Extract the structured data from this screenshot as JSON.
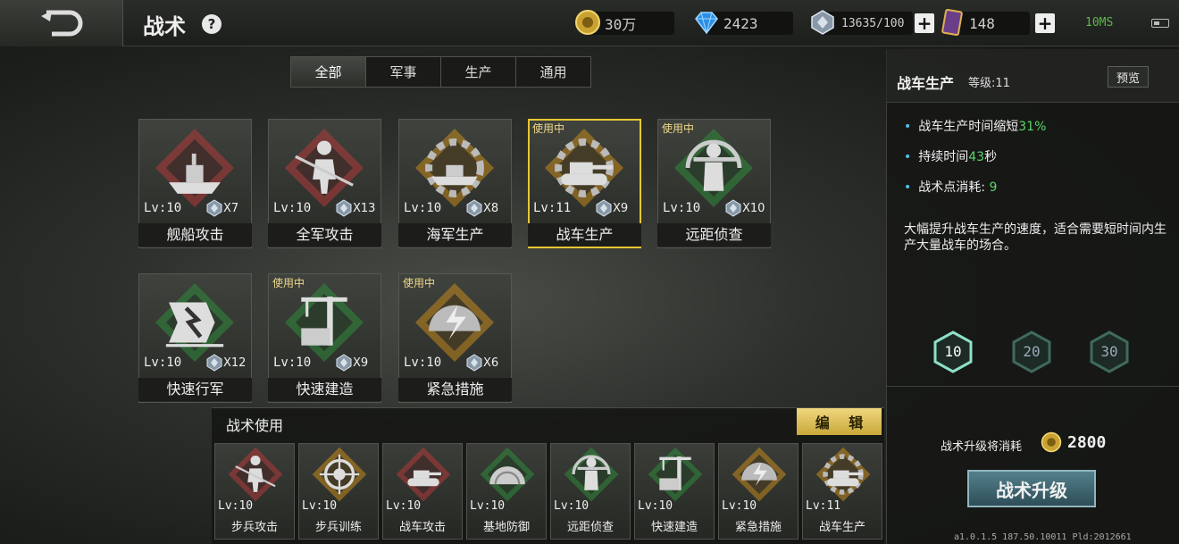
{
  "header": {
    "title": "战术",
    "help_symbol": "?",
    "gold": "30万",
    "diamonds": "2423",
    "crystals": "13635/100",
    "cards": "148",
    "plus_symbol": "+",
    "net": "10MS"
  },
  "tabs": [
    {
      "label": "全部",
      "active": true
    },
    {
      "label": "军事",
      "active": false
    },
    {
      "label": "生产",
      "active": false
    },
    {
      "label": "通用",
      "active": false
    }
  ],
  "cards": [
    {
      "name": "舰船攻击",
      "level": "Lv:10",
      "count": "X7",
      "in_use": "",
      "color": "#b23a3a",
      "icon": "ship-icon"
    },
    {
      "name": "全军攻击",
      "level": "Lv:10",
      "count": "X13",
      "in_use": "",
      "color": "#b23a3a",
      "icon": "soldier-icon"
    },
    {
      "name": "海军生产",
      "level": "Lv:10",
      "count": "X8",
      "in_use": "",
      "color": "#c48a1c",
      "icon": "warship-gear-icon"
    },
    {
      "name": "战车生产",
      "level": "Lv:11",
      "count": "X9",
      "in_use": "使用中",
      "color": "#c48a1c",
      "icon": "tank-gear-icon"
    },
    {
      "name": "远距侦查",
      "level": "Lv:10",
      "count": "X10",
      "in_use": "使用中",
      "color": "#2f8a3a",
      "icon": "sniper-icon"
    },
    {
      "name": "快速行军",
      "level": "Lv:10",
      "count": "X12",
      "in_use": "",
      "color": "#2f8a3a",
      "icon": "flag-arrow-icon"
    },
    {
      "name": "快速建造",
      "level": "Lv:10",
      "count": "X9",
      "in_use": "使用中",
      "color": "#2f8a3a",
      "icon": "crane-icon"
    },
    {
      "name": "紧急措施",
      "level": "Lv:10",
      "count": "X6",
      "in_use": "使用中",
      "color": "#c48a1c",
      "icon": "shield-bolt-icon"
    }
  ],
  "usage": {
    "title": "战术使用",
    "edit_label": "编 辑",
    "slots": [
      {
        "name": "步兵攻击",
        "level": "Lv:10",
        "color": "#b23a3a",
        "icon": "soldier-icon"
      },
      {
        "name": "步兵训练",
        "level": "Lv:10",
        "color": "#c48a1c",
        "icon": "target-icon"
      },
      {
        "name": "战车攻击",
        "level": "Lv:10",
        "color": "#b23a3a",
        "icon": "tank-icon"
      },
      {
        "name": "基地防御",
        "level": "Lv:10",
        "color": "#2f8a3a",
        "icon": "dome-icon"
      },
      {
        "name": "远距侦查",
        "level": "Lv:10",
        "color": "#2f8a3a",
        "icon": "sniper-icon"
      },
      {
        "name": "快速建造",
        "level": "Lv:10",
        "color": "#2f8a3a",
        "icon": "crane-icon"
      },
      {
        "name": "紧急措施",
        "level": "Lv:10",
        "color": "#c48a1c",
        "icon": "shield-bolt-icon"
      },
      {
        "name": "战车生产",
        "level": "Lv:11",
        "color": "#c48a1c",
        "icon": "tank-gear-icon"
      }
    ]
  },
  "detail": {
    "title": "战车生产",
    "level_label": "等级:11",
    "preview_label": "预览",
    "bullet1_text": "战车生产时间缩短",
    "bullet1_value": "31%",
    "bullet2_text": "持续时间",
    "bullet2_value": "43",
    "bullet2_unit": "秒",
    "bullet3_text": "战术点消耗:",
    "bullet3_value": "9",
    "description": "大幅提升战车生产的速度，适合需要短时间内生产大量战车的场合。",
    "level_buttons": [
      "10",
      "20",
      "30"
    ],
    "cost_label": "战术升级将消耗",
    "cost_value": "2800",
    "upgrade_label": "战术升级",
    "version": "a1.0.1.5 187.50.10011 Pld:2012661"
  },
  "colors": {
    "red_rank": "#b23a3a",
    "gold_rank": "#c48a1c",
    "green_rank": "#2f8a3a",
    "selected_border": "#e6c832",
    "highlight_green": "#5ad66a",
    "bullet_blue": "#4fc2e6"
  }
}
